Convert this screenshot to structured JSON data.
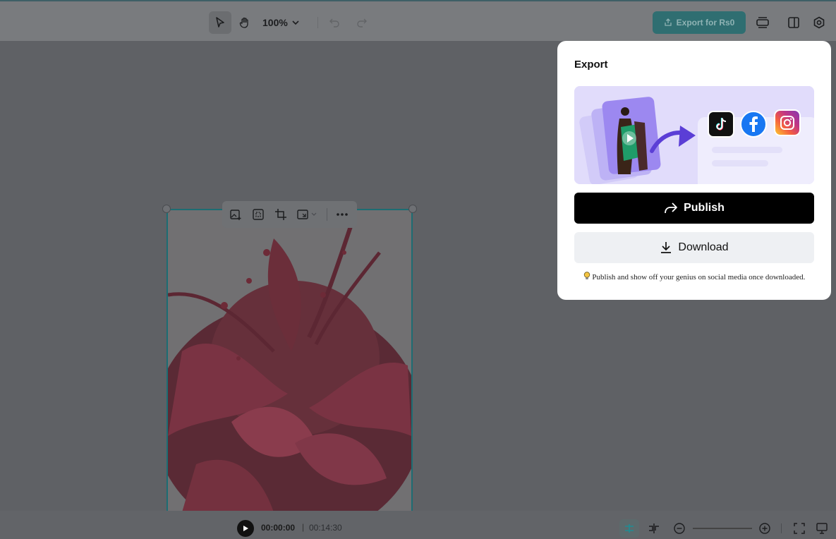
{
  "toolbar": {
    "zoom_label": "100%",
    "export_label": "Export for Rs0",
    "icons": [
      "select-pointer-icon",
      "hand-icon",
      "chevron-down-icon",
      "undo-icon",
      "redo-icon",
      "layers-icon",
      "panel-toggle-icon",
      "settings-icon"
    ]
  },
  "playback": {
    "current_time": "00:00:00",
    "separator": "|",
    "total_time": "00:14:30"
  },
  "export_panel": {
    "title": "Export",
    "publish_label": "Publish",
    "download_label": "Download",
    "tip": "Publish and show off your genius on social media once downloaded.",
    "social_icons": [
      "tiktok-icon",
      "facebook-icon",
      "instagram-icon"
    ]
  },
  "colors": {
    "accent_teal": "#2f6e71",
    "publish_bg": "#000000",
    "download_bg": "#eef0f3",
    "selection_border": "#1d6d73"
  }
}
